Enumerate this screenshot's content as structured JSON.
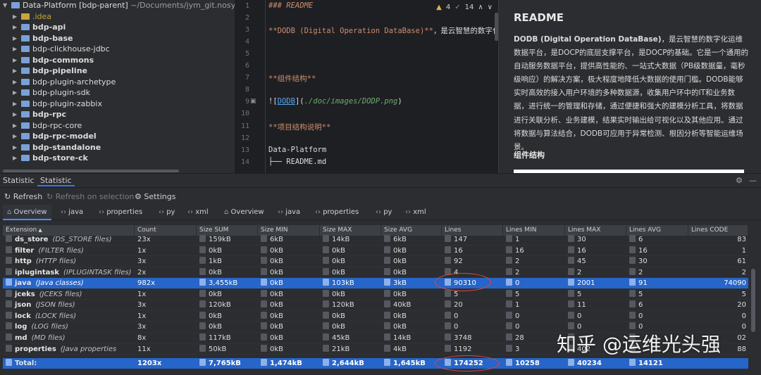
{
  "project": {
    "root": "Data-Platform [bdp-parent]",
    "root_path": "~/Documents/jym_git.nosync/D",
    "items": [
      {
        "label": ".idea",
        "style": "yellow"
      },
      {
        "label": "bdp-api",
        "style": "bold"
      },
      {
        "label": "bdp-base",
        "style": "bold"
      },
      {
        "label": "bdp-clickhouse-jdbc",
        "style": "normal"
      },
      {
        "label": "bdp-commons",
        "style": "bold"
      },
      {
        "label": "bdp-pipeline",
        "style": "bold"
      },
      {
        "label": "bdp-plugin-archetype",
        "style": "normal"
      },
      {
        "label": "bdp-plugin-sdk",
        "style": "normal"
      },
      {
        "label": "bdp-plugin-zabbix",
        "style": "normal"
      },
      {
        "label": "bdp-rpc",
        "style": "bold"
      },
      {
        "label": "bdp-rpc-core",
        "style": "normal"
      },
      {
        "label": "bdp-rpc-model",
        "style": "bold"
      },
      {
        "label": "bdp-standalone",
        "style": "bold"
      },
      {
        "label": "bdp-store-ck",
        "style": "bold"
      }
    ]
  },
  "editor": {
    "warnings": "4",
    "checks": "14",
    "lines": [
      {
        "n": "1",
        "parts": [
          {
            "c": "md-h",
            "t": "### README"
          }
        ]
      },
      {
        "n": "2",
        "parts": []
      },
      {
        "n": "3",
        "parts": [
          {
            "c": "md-b",
            "t": "**"
          },
          {
            "c": "md-b",
            "t": "DODB (Digital Operation DataBase)"
          },
          {
            "c": "md-b",
            "t": "**"
          },
          {
            "c": "md-t",
            "t": "，是云智慧的数字化"
          }
        ]
      },
      {
        "n": "4",
        "parts": []
      },
      {
        "n": "5",
        "parts": []
      },
      {
        "n": "6",
        "parts": []
      },
      {
        "n": "7",
        "parts": [
          {
            "c": "md-b",
            "t": "**组件结构**"
          }
        ]
      },
      {
        "n": "8",
        "parts": []
      },
      {
        "n": "9",
        "parts": [
          {
            "c": "md-t",
            "t": "!["
          },
          {
            "c": "md-link",
            "t": "DODB"
          },
          {
            "c": "md-t",
            "t": "]("
          },
          {
            "c": "md-path",
            "t": "./doc/images/DODP.png"
          },
          {
            "c": "md-t",
            "t": ")"
          }
        ]
      },
      {
        "n": "10",
        "parts": []
      },
      {
        "n": "11",
        "parts": [
          {
            "c": "md-b",
            "t": "**项目结构说明**"
          }
        ]
      },
      {
        "n": "12",
        "parts": []
      },
      {
        "n": "13",
        "parts": [
          {
            "c": "md-t",
            "t": "Data-Platform"
          }
        ]
      },
      {
        "n": "14",
        "parts": [
          {
            "c": "md-t",
            "t": "├── README.md"
          }
        ]
      }
    ]
  },
  "preview": {
    "title": "README",
    "para": "DODB (Digital Operation DataBase)，是云智慧的数字化运维数据平台，是DOCP的底层支撑平台，是DOCP的基础。它是一个通用的自动服务数据平台，提供高性能的、一站式大数据（PB级数据量，毫秒级响应）的解决方案，极大程度地降低大数据的使用门槛。DODB能够实时高效的接入用户环境的多种数据源，收集用户环中的IT和业务数据，进行统一的管理和存储，通过便捷和强大的建模分析工具，将数据进行关联分析、业务建模，结果实时输出给可视化以及其他应用。通过将数据与算法结合，DODB可应用于异常检测、根因分析等智能运维场景。",
    "para_bold": "DODB (Digital Operation DataBase)",
    "heading": "组件结构"
  },
  "toolwindow": {
    "tab1": "Statistic",
    "tab2": "Statistic",
    "refresh": "Refresh",
    "refresh_selection": "Refresh on selection",
    "settings": "Settings",
    "tabs": [
      "Overview",
      "java",
      "properties",
      "py",
      "xml",
      "Overview",
      "java",
      "properties",
      "py",
      "xml"
    ]
  },
  "table": {
    "columns": [
      "Extension",
      "Count",
      "Size SUM",
      "Size MIN",
      "Size MAX",
      "Size AVG",
      "Lines",
      "Lines MIN",
      "Lines MAX",
      "Lines AVG",
      "Lines CODE"
    ],
    "rows": [
      {
        "ext": "ds_store",
        "desc": "(DS_STORE files)",
        "count": "23x",
        "sum": "159kB",
        "min": "6kB",
        "max": "14kB",
        "avg": "6kB",
        "lines": "147",
        "lmin": "1",
        "lmax": "30",
        "lavg": "6",
        "lcode": "83"
      },
      {
        "ext": "filter",
        "desc": "(FILTER files)",
        "count": "1x",
        "sum": "0kB",
        "min": "0kB",
        "max": "0kB",
        "avg": "0kB",
        "lines": "16",
        "lmin": "16",
        "lmax": "16",
        "lavg": "16",
        "lcode": "1"
      },
      {
        "ext": "http",
        "desc": "(HTTP files)",
        "count": "3x",
        "sum": "1kB",
        "min": "0kB",
        "max": "0kB",
        "avg": "0kB",
        "lines": "92",
        "lmin": "2",
        "lmax": "45",
        "lavg": "30",
        "lcode": "61"
      },
      {
        "ext": "iplugintask",
        "desc": "(IPLUGINTASK files)",
        "count": "2x",
        "sum": "0kB",
        "min": "0kB",
        "max": "0kB",
        "avg": "0kB",
        "lines": "4",
        "lmin": "2",
        "lmax": "2",
        "lavg": "2",
        "lcode": "2"
      },
      {
        "ext": "java",
        "desc": "(Java classes)",
        "count": "982x",
        "sum": "3,455kB",
        "min": "0kB",
        "max": "103kB",
        "avg": "3kB",
        "lines": "90310",
        "lmin": "0",
        "lmax": "2001",
        "lavg": "91",
        "lcode": "74090",
        "selected": true
      },
      {
        "ext": "jceks",
        "desc": "(JCEKS files)",
        "count": "1x",
        "sum": "0kB",
        "min": "0kB",
        "max": "0kB",
        "avg": "0kB",
        "lines": "5",
        "lmin": "5",
        "lmax": "5",
        "lavg": "5",
        "lcode": "5"
      },
      {
        "ext": "json",
        "desc": "(JSON files)",
        "count": "3x",
        "sum": "120kB",
        "min": "0kB",
        "max": "120kB",
        "avg": "40kB",
        "lines": "20",
        "lmin": "1",
        "lmax": "11",
        "lavg": "6",
        "lcode": "20"
      },
      {
        "ext": "lock",
        "desc": "(LOCK files)",
        "count": "1x",
        "sum": "0kB",
        "min": "0kB",
        "max": "0kB",
        "avg": "0kB",
        "lines": "0",
        "lmin": "0",
        "lmax": "0",
        "lavg": "0",
        "lcode": "0"
      },
      {
        "ext": "log",
        "desc": "(LOG files)",
        "count": "3x",
        "sum": "0kB",
        "min": "0kB",
        "max": "0kB",
        "avg": "0kB",
        "lines": "0",
        "lmin": "0",
        "lmax": "0",
        "lavg": "0",
        "lcode": "0"
      },
      {
        "ext": "md",
        "desc": "(MD files)",
        "count": "8x",
        "sum": "117kB",
        "min": "0kB",
        "max": "45kB",
        "avg": "14kB",
        "lines": "3748",
        "lmin": "28",
        "lmax": "",
        "lavg": "",
        "lcode": "02"
      },
      {
        "ext": "properties",
        "desc": "(Java properties",
        "count": "11x",
        "sum": "50kB",
        "min": "0kB",
        "max": "21kB",
        "avg": "4kB",
        "lines": "1192",
        "lmin": "3",
        "lmax": "402",
        "lavg": "",
        "lcode": "88"
      }
    ],
    "total": {
      "ext": "Total:",
      "count": "1203x",
      "sum": "7,765kB",
      "min": "1,474kB",
      "max": "2,644kB",
      "avg": "1,645kB",
      "lines": "174252",
      "lmin": "10258",
      "lmax": "40234",
      "lavg": "14121",
      "lcode": ""
    }
  },
  "watermark": "知乎 @运维光头强",
  "colors": {
    "selection": "#2665c9",
    "annotation": "#e8453c"
  }
}
